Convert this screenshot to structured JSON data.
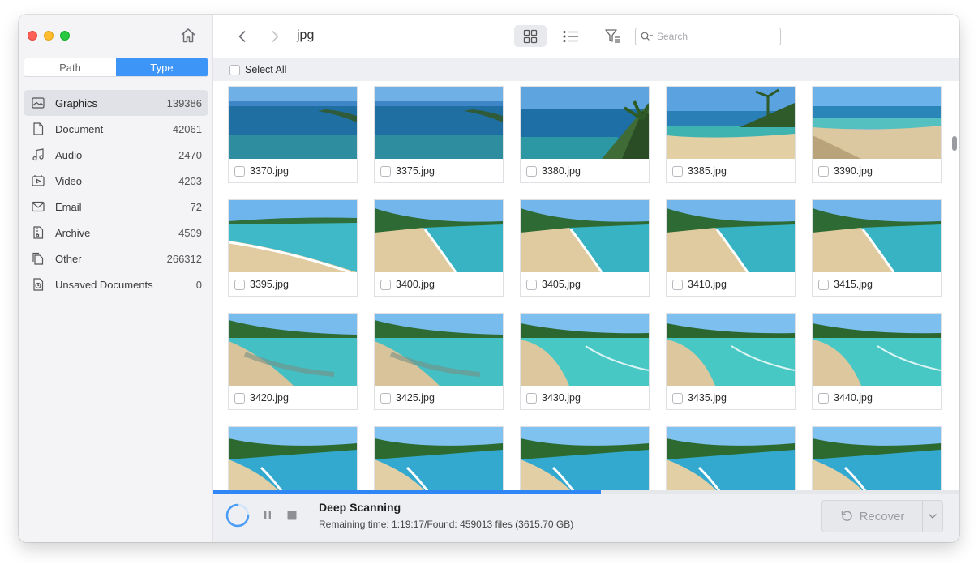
{
  "sidebar": {
    "tabs": [
      {
        "label": "Path",
        "active": false
      },
      {
        "label": "Type",
        "active": true
      }
    ],
    "categories": [
      {
        "label": "Graphics",
        "count": "139386",
        "icon": "image-icon",
        "selected": true
      },
      {
        "label": "Document",
        "count": "42061",
        "icon": "document-icon",
        "selected": false
      },
      {
        "label": "Audio",
        "count": "2470",
        "icon": "music-note-icon",
        "selected": false
      },
      {
        "label": "Video",
        "count": "4203",
        "icon": "video-icon",
        "selected": false
      },
      {
        "label": "Email",
        "count": "72",
        "icon": "envelope-icon",
        "selected": false
      },
      {
        "label": "Archive",
        "count": "4509",
        "icon": "archive-icon",
        "selected": false
      },
      {
        "label": "Other",
        "count": "266312",
        "icon": "files-icon",
        "selected": false
      },
      {
        "label": "Unsaved Documents",
        "count": "0",
        "icon": "unsaved-document-icon",
        "selected": false
      }
    ]
  },
  "toolbar": {
    "breadcrumb": "jpg",
    "search_placeholder": "Search"
  },
  "select_all_label": "Select All",
  "files": [
    {
      "name": "3370.jpg",
      "scene": "ocean"
    },
    {
      "name": "3375.jpg",
      "scene": "ocean"
    },
    {
      "name": "3380.jpg",
      "scene": "palm"
    },
    {
      "name": "3385.jpg",
      "scene": "palm-beach"
    },
    {
      "name": "3390.jpg",
      "scene": "beach-shade"
    },
    {
      "name": "3395.jpg",
      "scene": "shore"
    },
    {
      "name": "3400.jpg",
      "scene": "shore-forest"
    },
    {
      "name": "3405.jpg",
      "scene": "shore-forest"
    },
    {
      "name": "3410.jpg",
      "scene": "shore-forest"
    },
    {
      "name": "3415.jpg",
      "scene": "shore-forest"
    },
    {
      "name": "3420.jpg",
      "scene": "reef"
    },
    {
      "name": "3425.jpg",
      "scene": "reef"
    },
    {
      "name": "3430.jpg",
      "scene": "lagoon"
    },
    {
      "name": "3435.jpg",
      "scene": "lagoon"
    },
    {
      "name": "3440.jpg",
      "scene": "lagoon"
    },
    {
      "name": "",
      "scene": "aerial"
    },
    {
      "name": "",
      "scene": "aerial"
    },
    {
      "name": "",
      "scene": "aerial"
    },
    {
      "name": "",
      "scene": "aerial"
    },
    {
      "name": "",
      "scene": "aerial"
    }
  ],
  "status": {
    "title": "Deep Scanning",
    "detail": "Remaining time: 1:19:17/Found: 459013 files (3615.70 GB)",
    "progress": 0.52,
    "recover_label": "Recover"
  },
  "colors": {
    "accent": "#3d96f7",
    "progress": "#2f86f5",
    "traffic_red": "#ff5f57",
    "traffic_yellow": "#febc2e",
    "traffic_green": "#28c840"
  }
}
